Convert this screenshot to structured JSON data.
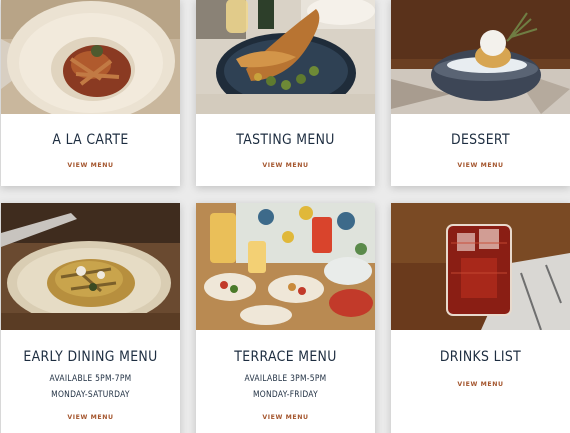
{
  "cards": [
    {
      "title": "A LA CARTE",
      "link": "VIEW MENU",
      "image": "pasta-plate-photo"
    },
    {
      "title": "TASTING MENU",
      "link": "VIEW MENU",
      "image": "roast-poussin-photo"
    },
    {
      "title": "DESSERT",
      "link": "VIEW MENU",
      "image": "dessert-bowl-photo"
    },
    {
      "title": "EARLY DINING MENU",
      "sub1": "AVAILABLE 5PM-7PM",
      "sub2": "MONDAY-SATURDAY",
      "link": "VIEW MENU",
      "image": "gnocchi-plate-photo"
    },
    {
      "title": "TERRACE MENU",
      "sub1": "AVAILABLE 3PM-5PM",
      "sub2": "MONDAY-FRIDAY",
      "link": "VIEW MENU",
      "image": "terrace-spread-photo"
    },
    {
      "title": "DRINKS LIST",
      "link": "VIEW MENU",
      "image": "negroni-cocktail-photo"
    }
  ],
  "colors": {
    "title": "#1d2d40",
    "link": "#a4552d",
    "card": "#ffffff",
    "page": "#ebebeb"
  }
}
